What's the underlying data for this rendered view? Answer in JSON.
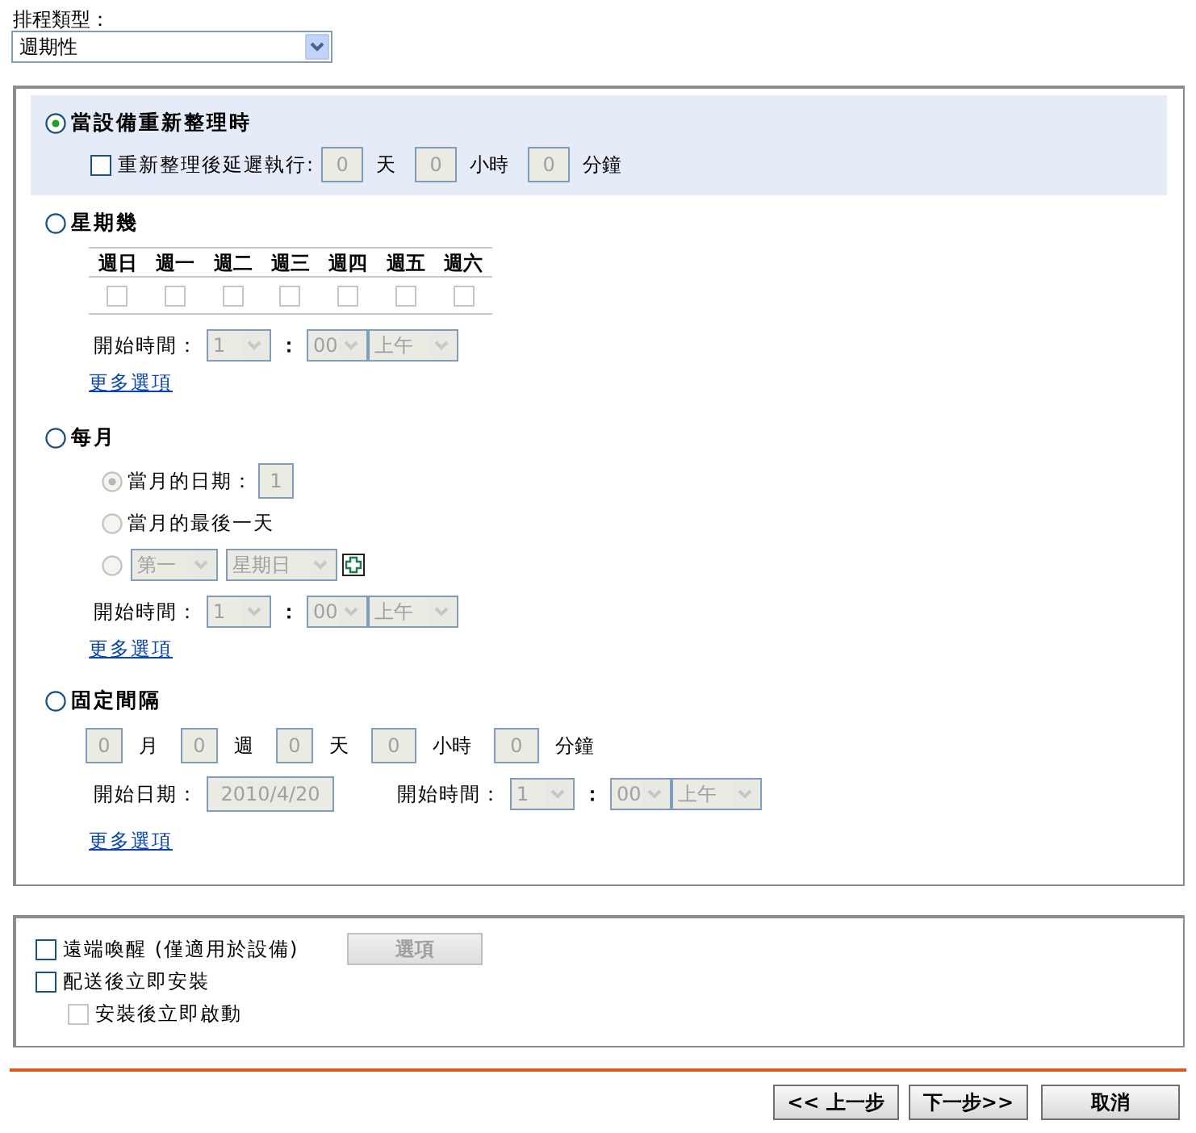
{
  "schedule_type": {
    "label": "排程類型：",
    "value": "週期性"
  },
  "options": [
    {
      "kind": "refresh",
      "label": "當設備重新整理時",
      "selected": true,
      "delay": {
        "label": "重新整理後延遲執行:",
        "checked": false,
        "fields": [
          {
            "value": "0",
            "unit": "天"
          },
          {
            "value": "0",
            "unit": "小時"
          },
          {
            "value": "0",
            "unit": "分鐘"
          }
        ]
      }
    },
    {
      "kind": "weekly",
      "label": "星期幾",
      "selected": false,
      "days": [
        {
          "label": "週日",
          "checked": false
        },
        {
          "label": "週一",
          "checked": false
        },
        {
          "label": "週二",
          "checked": false
        },
        {
          "label": "週三",
          "checked": false
        },
        {
          "label": "週四",
          "checked": false
        },
        {
          "label": "週五",
          "checked": false
        },
        {
          "label": "週六",
          "checked": false
        }
      ],
      "start_time": {
        "label": "開始時間：",
        "hour": "1",
        "separator": "：",
        "minute": "00",
        "ampm": "上午"
      },
      "more": "更多選項"
    },
    {
      "kind": "monthly",
      "label": "每月",
      "selected": false,
      "choices": [
        {
          "kind": "date",
          "label": "當月的日期：",
          "value": "1",
          "selected": true
        },
        {
          "kind": "last",
          "label": "當月的最後一天",
          "selected": false
        },
        {
          "kind": "nth",
          "ordinal": "第一",
          "weekday": "星期日",
          "selected": false
        }
      ],
      "start_time": {
        "label": "開始時間：",
        "hour": "1",
        "separator": "：",
        "minute": "00",
        "ampm": "上午"
      },
      "more": "更多選項"
    },
    {
      "kind": "interval",
      "label": "固定間隔",
      "selected": false,
      "fields": [
        {
          "value": "0",
          "unit": "月"
        },
        {
          "value": "0",
          "unit": "週"
        },
        {
          "value": "0",
          "unit": "天"
        },
        {
          "value": "0",
          "unit": "小時"
        },
        {
          "value": "0",
          "unit": "分鐘"
        }
      ],
      "start_date": {
        "label": "開始日期：",
        "value": "2010/4/20"
      },
      "start_time": {
        "label": "開始時間：",
        "hour": "1",
        "separator": "：",
        "minute": "00",
        "ampm": "上午"
      },
      "more": "更多選項"
    }
  ],
  "extras": [
    {
      "label": "遠端喚醒 (僅適用於設備)",
      "checked": false,
      "disabled": false,
      "button": {
        "label": "選項",
        "disabled": true
      }
    },
    {
      "label": "配送後立即安裝",
      "checked": false,
      "disabled": false,
      "children": [
        {
          "label": "安裝後立即啟動",
          "checked": false,
          "disabled": true
        }
      ]
    }
  ],
  "buttons": [
    {
      "label": "<< 上一步"
    },
    {
      "label": "下一步>>"
    },
    {
      "label": "取消"
    }
  ]
}
